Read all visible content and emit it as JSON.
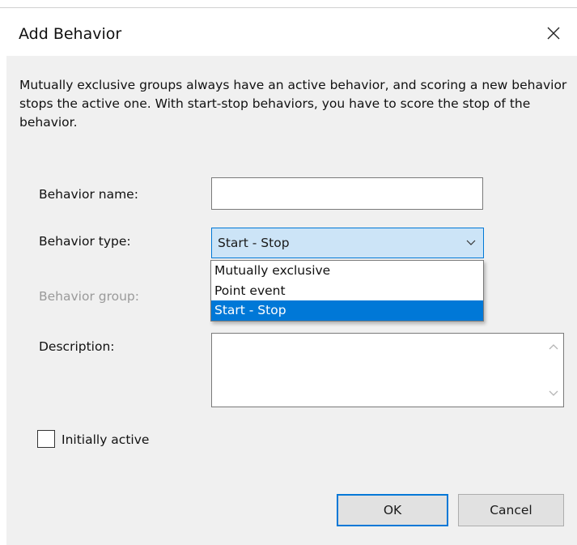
{
  "dialog": {
    "title": "Add Behavior",
    "close_icon": "close-icon",
    "description": "Mutually exclusive groups always have an active behavior, and scoring a new behavior stops the active one. With start-stop behaviors, you have to score the stop of the behavior."
  },
  "form": {
    "name_label": "Behavior name:",
    "name_value": "",
    "type_label": "Behavior type:",
    "type_value": "Start - Stop",
    "type_options": [
      "Mutually exclusive",
      "Point event",
      "Start - Stop"
    ],
    "group_label": "Behavior group:",
    "description_label": "Description:",
    "description_value": "",
    "initially_active_label": "Initially active",
    "initially_active_checked": false
  },
  "buttons": {
    "ok": "OK",
    "cancel": "Cancel"
  },
  "colors": {
    "accent": "#0078d7",
    "select_bg": "#cce4f7",
    "dialog_bg": "#f0f0f0"
  }
}
